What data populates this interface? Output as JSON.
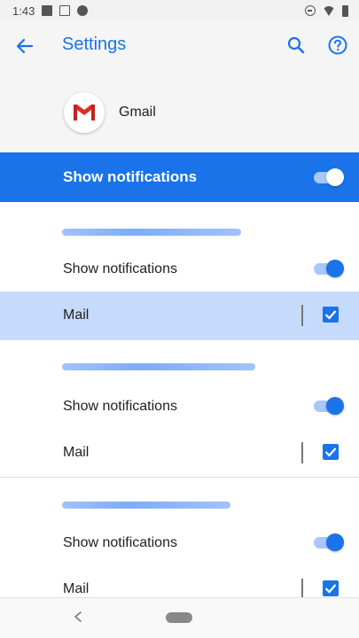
{
  "status_bar": {
    "time": "1:43"
  },
  "toolbar": {
    "title": "Settings"
  },
  "app": {
    "name": "Gmail"
  },
  "master": {
    "label": "Show notifications",
    "enabled": true
  },
  "groups": [
    {
      "show_label": "Show notifications",
      "show_enabled": true,
      "mail_label": "Mail",
      "mail_checked": true
    },
    {
      "show_label": "Show notifications",
      "show_enabled": true,
      "mail_label": "Mail",
      "mail_checked": true
    },
    {
      "show_label": "Show notifications",
      "show_enabled": true,
      "mail_label": "Mail",
      "mail_checked": true
    }
  ],
  "colors": {
    "accent": "#1a73e8",
    "highlight_row": "#c6dafc",
    "header_bg": "#f5f5f5"
  },
  "icons": {
    "back": "arrow-back-icon",
    "search": "search-icon",
    "help": "help-icon",
    "app": "gmail-logo-icon"
  }
}
